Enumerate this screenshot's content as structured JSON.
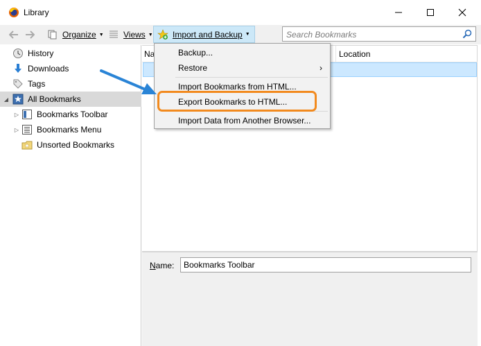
{
  "window": {
    "title": "Library",
    "minimize_icon": "minimize-icon",
    "maximize_icon": "maximize-icon",
    "close_icon": "close-icon"
  },
  "toolbar": {
    "back_icon": "back-arrow-icon",
    "forward_icon": "forward-arrow-icon",
    "organize_label": "Organize",
    "views_label": "Views",
    "import_backup_label": "Import and Backup",
    "search_placeholder": "Search Bookmarks"
  },
  "sidebar": {
    "items": [
      {
        "label": "History",
        "icon": "clock-icon"
      },
      {
        "label": "Downloads",
        "icon": "download-icon"
      },
      {
        "label": "Tags",
        "icon": "tag-icon"
      },
      {
        "label": "All Bookmarks",
        "icon": "star-icon",
        "selected": true
      },
      {
        "label": "Bookmarks Toolbar",
        "icon": "toolbar-folder-icon"
      },
      {
        "label": "Bookmarks Menu",
        "icon": "menu-folder-icon"
      },
      {
        "label": "Unsorted Bookmarks",
        "icon": "unsorted-folder-icon"
      }
    ]
  },
  "content": {
    "columns": [
      "Na",
      "Location"
    ]
  },
  "details": {
    "name_label": "Name:",
    "name_value": "Bookmarks Toolbar"
  },
  "menu": {
    "items": [
      {
        "label": "Backup..."
      },
      {
        "label": "Restore"
      },
      {
        "label": "Import Bookmarks from HTML..."
      },
      {
        "label": "Export Bookmarks to HTML..."
      },
      {
        "label": "Import Data from Another Browser..."
      }
    ]
  },
  "colors": {
    "highlight_ring": "#f28a1e",
    "annotation_arrow": "#2a84d6",
    "selection": "#cce8ff"
  }
}
